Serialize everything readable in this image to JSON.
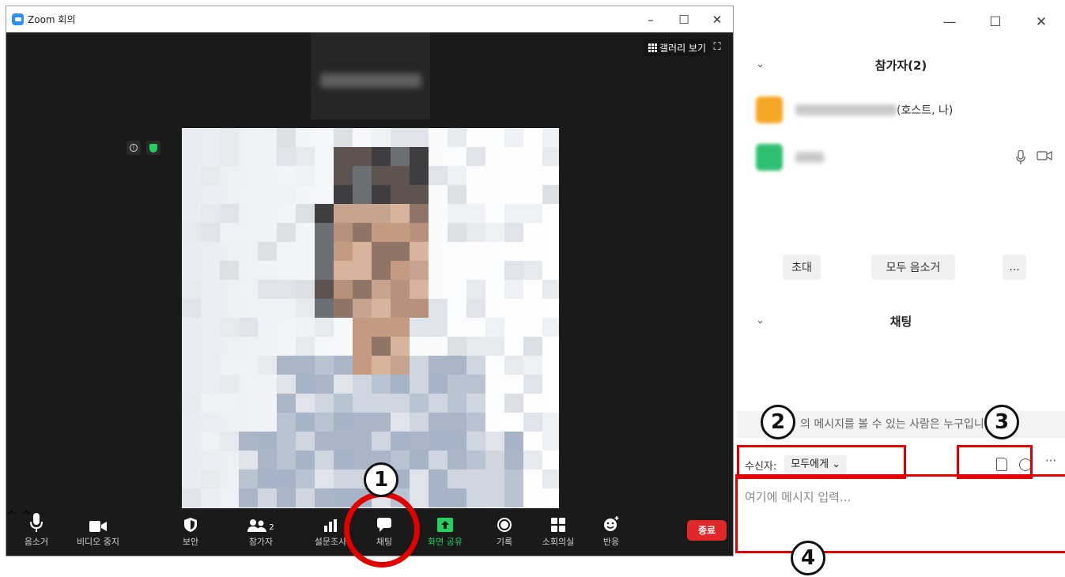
{
  "meeting_window": {
    "title": "Zoom 회의",
    "controls": {
      "minimize": "–",
      "maximize": "☐",
      "close": "✕"
    },
    "gallery_view_label": "갤러리 보기"
  },
  "toolbar": {
    "mute": "음소거",
    "stop_video": "비디오 중지",
    "security": "보안",
    "participants": "참가자",
    "participants_count": "2",
    "polls": "설문조사",
    "chat": "채팅",
    "share_screen": "화면 공유",
    "record": "기록",
    "breakout": "소회의실",
    "reactions": "반응",
    "end": "종료"
  },
  "panel": {
    "controls": {
      "minimize": "—",
      "maximize": "☐",
      "close": "✕"
    },
    "participants_title": "참가자(2)",
    "participant_1_role": "(호스트, 나)",
    "invite": "초대",
    "mute_all": "모두 음소거",
    "more": "...",
    "chat_title": "채팅",
    "chat_question": "의 메시지를 볼 수 있는 사람은 누구입니까?",
    "recipient_label": "수신자:",
    "recipient_value": "모두에게",
    "more_options": "···",
    "input_placeholder": "여기에 메시지 입력..."
  },
  "annotations": {
    "n1": "1",
    "n2": "2",
    "n3": "3",
    "n4": "4"
  },
  "colors": {
    "annotation_red": "#e00000",
    "end_button": "#e02828",
    "share_green": "#23d160",
    "zoom_blue": "#2d8cff"
  }
}
